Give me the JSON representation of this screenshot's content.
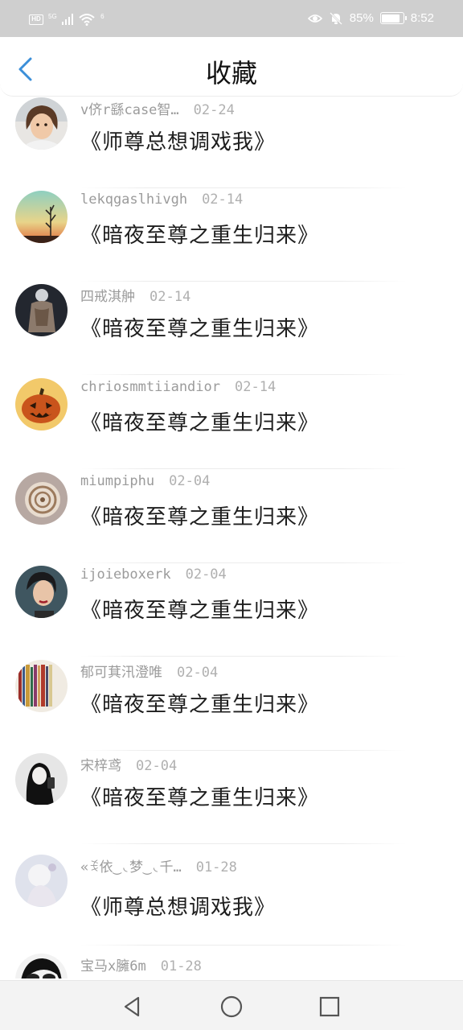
{
  "status_bar": {
    "hd": "HD",
    "signal_tag": "5G",
    "wifi_tag": "6",
    "battery_text": "85%",
    "battery_level": 0.85,
    "time": "8:52",
    "icons": [
      "eye-icon",
      "mute-bell-icon",
      "battery-icon"
    ]
  },
  "header": {
    "title": "收藏",
    "back_icon": "chevron-left-icon",
    "accent_color": "#3b8fd9"
  },
  "items": [
    {
      "username": "v侪r繇case智…",
      "date": "02-24",
      "book": "《师尊总想调戏我》",
      "avatar": "child-photo"
    },
    {
      "username": "lekqgaslhivgh",
      "date": "02-14",
      "book": "《暗夜至尊之重生归来》",
      "avatar": "sunset-tree"
    },
    {
      "username": "四戒淇舯",
      "date": "02-14",
      "book": "《暗夜至尊之重生归来》",
      "avatar": "figure-back"
    },
    {
      "username": "chriosmmtiiandior",
      "date": "02-14",
      "book": "《暗夜至尊之重生归来》",
      "avatar": "pumpkin"
    },
    {
      "username": "miumpiphu",
      "date": "02-04",
      "book": "《暗夜至尊之重生归来》",
      "avatar": "seashell"
    },
    {
      "username": "ijoieboxerk",
      "date": "02-04",
      "book": "《暗夜至尊之重生归来》",
      "avatar": "woman-portrait"
    },
    {
      "username": "郁可萁汛澄唯",
      "date": "02-04",
      "book": "《暗夜至尊之重生归来》",
      "avatar": "bookshelf"
    },
    {
      "username": "宋梓鸢",
      "date": "02-04",
      "book": "《暗夜至尊之重生归来》",
      "avatar": "girl-phone"
    },
    {
      "username": "«ꉂ依‿◟梦‿◟千…",
      "date": "01-28",
      "book": "《师尊总想调戏我》",
      "avatar": "pale-figure"
    },
    {
      "username": "宝马x臃6m",
      "date": "01-28",
      "book": "",
      "avatar": "bw-photo"
    }
  ],
  "nav_bar": {
    "icons": [
      "back-triangle-icon",
      "home-circle-icon",
      "recents-square-icon"
    ]
  }
}
